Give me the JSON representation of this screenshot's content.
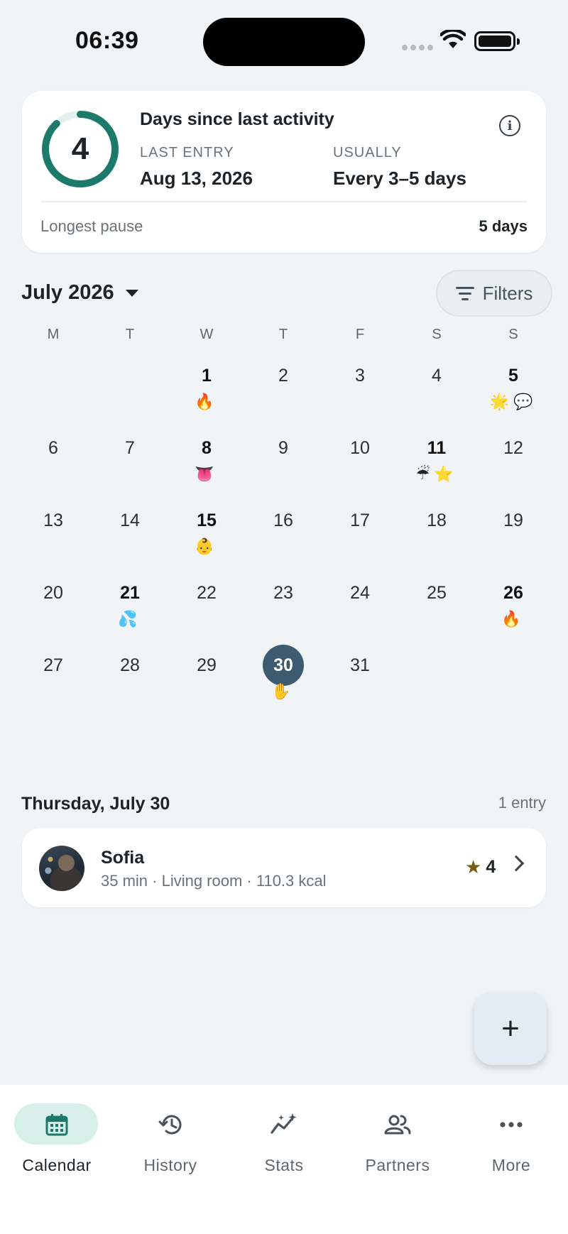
{
  "status_bar": {
    "time": "06:39"
  },
  "summary": {
    "days_count": "4",
    "title": "Days since last activity",
    "last_entry_label": "LAST ENTRY",
    "last_entry_value": "Aug 13, 2026",
    "usually_label": "USUALLY",
    "usually_value": "Every 3–5 days",
    "longest_pause_label": "Longest pause",
    "longest_pause_value": "5 days",
    "info_icon": "i",
    "ring_color": "#1b7a6a",
    "ring_track_color": "#e4f1ee",
    "ring_progress": 0.88
  },
  "calendar": {
    "month_label": "July 2026",
    "filters_label": "Filters",
    "weekdays": [
      "M",
      "T",
      "W",
      "T",
      "F",
      "S",
      "S"
    ],
    "leading_blank_days": 2,
    "days": [
      {
        "n": "1",
        "emojis": "🔥",
        "bold": true
      },
      {
        "n": "2",
        "emojis": "",
        "bold": false
      },
      {
        "n": "3",
        "emojis": "",
        "bold": false
      },
      {
        "n": "4",
        "emojis": "",
        "bold": false
      },
      {
        "n": "5",
        "emojis": "🌟💬",
        "bold": true
      },
      {
        "n": "6",
        "emojis": "",
        "bold": false
      },
      {
        "n": "7",
        "emojis": "",
        "bold": false
      },
      {
        "n": "8",
        "emojis": "👅",
        "bold": true
      },
      {
        "n": "9",
        "emojis": "",
        "bold": false
      },
      {
        "n": "10",
        "emojis": "",
        "bold": false
      },
      {
        "n": "11",
        "emojis": "☔⭐",
        "bold": true
      },
      {
        "n": "12",
        "emojis": "",
        "bold": false
      },
      {
        "n": "13",
        "emojis": "",
        "bold": false
      },
      {
        "n": "14",
        "emojis": "",
        "bold": false
      },
      {
        "n": "15",
        "emojis": "👶",
        "bold": true
      },
      {
        "n": "16",
        "emojis": "",
        "bold": false
      },
      {
        "n": "17",
        "emojis": "",
        "bold": false
      },
      {
        "n": "18",
        "emojis": "",
        "bold": false
      },
      {
        "n": "19",
        "emojis": "",
        "bold": false
      },
      {
        "n": "20",
        "emojis": "",
        "bold": false
      },
      {
        "n": "21",
        "emojis": "💦",
        "bold": true
      },
      {
        "n": "22",
        "emojis": "",
        "bold": false
      },
      {
        "n": "23",
        "emojis": "",
        "bold": false
      },
      {
        "n": "24",
        "emojis": "",
        "bold": false
      },
      {
        "n": "25",
        "emojis": "",
        "bold": false
      },
      {
        "n": "26",
        "emojis": "🔥",
        "bold": true
      },
      {
        "n": "27",
        "emojis": "",
        "bold": false
      },
      {
        "n": "28",
        "emojis": "",
        "bold": false
      },
      {
        "n": "29",
        "emojis": "",
        "bold": false
      },
      {
        "n": "30",
        "emojis": "✋",
        "bold": true,
        "today": true
      },
      {
        "n": "31",
        "emojis": "",
        "bold": false
      }
    ],
    "today_color": "#3c5a70"
  },
  "selected_day": {
    "date_label": "Thursday, July 30",
    "entry_count": "1 entry",
    "entries": [
      {
        "name": "Sofia",
        "meta": "35 min · Living room · 110.3 kcal",
        "rating": "4"
      }
    ]
  },
  "fab": {
    "label": "+"
  },
  "bottom_nav": {
    "items": [
      {
        "label": "Calendar",
        "icon": "calendar-icon",
        "active": true
      },
      {
        "label": "History",
        "icon": "history-icon",
        "active": false
      },
      {
        "label": "Stats",
        "icon": "stats-icon",
        "active": false
      },
      {
        "label": "Partners",
        "icon": "partners-icon",
        "active": false
      },
      {
        "label": "More",
        "icon": "more-icon",
        "active": false
      }
    ],
    "active_pill_color": "#d6efe9",
    "active_icon_color": "#1b7a6a"
  }
}
